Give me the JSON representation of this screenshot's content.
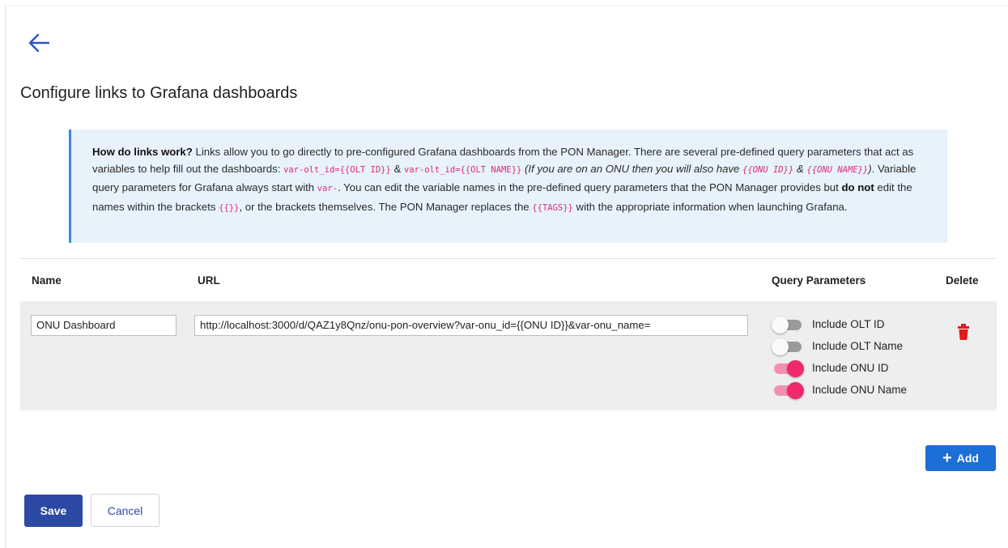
{
  "page": {
    "title": "Configure links to Grafana dashboards",
    "back_icon": "arrow-left-icon"
  },
  "info": {
    "heading": "How do links work?",
    "p1": " Links allow you to go directly to pre-configured Grafana dashboards from the PON Manager. There are several pre-defined query parameters that act as variables to help fill out the dashboards: ",
    "code1": "var-olt_id={{OLT ID}}",
    "amp1": " & ",
    "code2": "var-olt_id={{OLT NAME}}",
    "italic1": " (If you are on an ONU then you will also have ",
    "code3": "{{ONU ID}}",
    "italic_amp": " & ",
    "code4": "{{ONU NAME}}",
    "italic2": ")",
    "p2": ". Variable query parameters for Grafana always start with ",
    "code5": "var-",
    "p3": ". You can edit the variable names in the pre-defined query parameters that the PON Manager provides but ",
    "bold_not": "do not",
    "p4": " edit the names within the brackets ",
    "code6": "{{}}",
    "p5": ", or the brackets themselves. The PON Manager replaces the ",
    "code7": "{{TAGS}}",
    "p6": " with the appropriate information when launching Grafana."
  },
  "table": {
    "headers": {
      "name": "Name",
      "url": "URL",
      "query": "Query Parameters",
      "delete": "Delete"
    },
    "rows": [
      {
        "name": "ONU Dashboard",
        "url": "http://localhost:3000/d/QAZ1y8Qnz/onu-pon-overview?var-onu_id={{ONU ID}}&var-onu_name=",
        "toggles": [
          {
            "label": "Include OLT ID",
            "on": false
          },
          {
            "label": "Include OLT Name",
            "on": false
          },
          {
            "label": "Include ONU ID",
            "on": true
          },
          {
            "label": "Include ONU Name",
            "on": true
          }
        ],
        "delete_icon": "trash-icon"
      }
    ]
  },
  "buttons": {
    "add": "Add",
    "add_icon": "plus-icon",
    "save": "Save",
    "cancel": "Cancel"
  },
  "colors": {
    "primary": "#1b6fd6",
    "save": "#2c4aa3",
    "toggle_on": "#f0286e",
    "delete": "#e01b1b",
    "info_bg": "#e7f2fd",
    "info_border": "#3f86d8",
    "code": "#e0287a"
  }
}
